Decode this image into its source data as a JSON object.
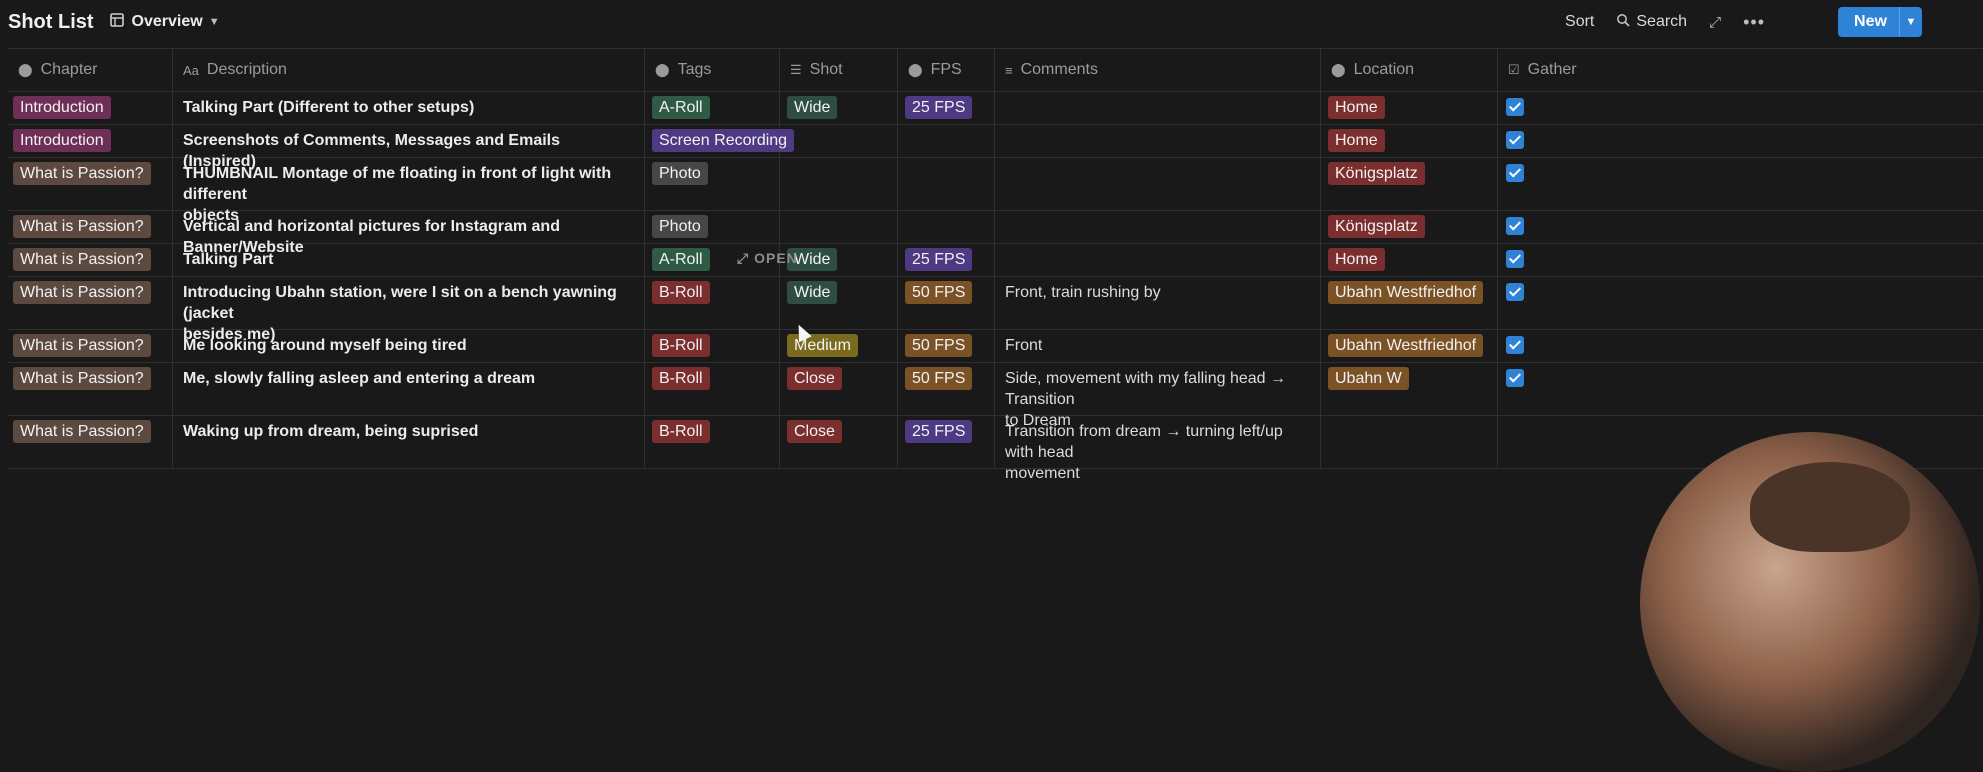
{
  "header": {
    "title": "Shot List",
    "view_label": "Overview",
    "sort_label": "Sort",
    "search_label": "Search",
    "new_label": "New"
  },
  "columns": [
    {
      "key": "chapter",
      "label": "Chapter",
      "icon": "select-icon"
    },
    {
      "key": "description",
      "label": "Description",
      "icon": "text-icon"
    },
    {
      "key": "tags",
      "label": "Tags",
      "icon": "select-icon"
    },
    {
      "key": "shot",
      "label": "Shot",
      "icon": "list-icon"
    },
    {
      "key": "fps",
      "label": "FPS",
      "icon": "select-icon"
    },
    {
      "key": "comments",
      "label": "Comments",
      "icon": "text-lines-icon"
    },
    {
      "key": "location",
      "label": "Location",
      "icon": "select-icon"
    },
    {
      "key": "gathered",
      "label": "Gather",
      "icon": "checkbox-icon"
    }
  ],
  "colors": {
    "introduction": "#6e2f57",
    "passion": "#5c4a41",
    "a_roll": "#2f5a46",
    "screen_recording": "#4e3a82",
    "photo": "#474747",
    "b_roll": "#7a2e2e",
    "wide": "#2e4e42",
    "medium": "#7a6a1e",
    "close": "#7a2e2e",
    "fps25": "#4e3a82",
    "fps50": "#7a5226",
    "home": "#7a2e2e",
    "konigsplatz": "#7a2e2e",
    "ubahn": "#7a5226",
    "accent": "#2f83d6"
  },
  "open_hint": "OPEN",
  "rows": [
    {
      "chapter": "Introduction",
      "chapter_color": "introduction",
      "description": [
        "Talking Part (Different to other setups)"
      ],
      "tags": "A-Roll",
      "tags_color": "a_roll",
      "shot": "Wide",
      "shot_color": "wide",
      "fps": "25 FPS",
      "fps_color": "fps25",
      "comments": [],
      "location": "Home",
      "location_color": "home",
      "gathered": true
    },
    {
      "chapter": "Introduction",
      "chapter_color": "introduction",
      "description": [
        "Screenshots of Comments, Messages and Emails (Inspired)"
      ],
      "tags": "Screen Recording",
      "tags_color": "screen_recording",
      "shot": "",
      "shot_color": "",
      "fps": "",
      "fps_color": "",
      "comments": [],
      "location": "Home",
      "location_color": "home",
      "gathered": true
    },
    {
      "chapter": "What is Passion?",
      "chapter_color": "passion",
      "description": [
        "THUMBNAIL Montage of me floating in front of light with different",
        "objects"
      ],
      "tags": "Photo",
      "tags_color": "photo",
      "shot": "",
      "shot_color": "",
      "fps": "",
      "fps_color": "",
      "comments": [],
      "location": "Königsplatz",
      "location_color": "konigsplatz",
      "gathered": true
    },
    {
      "chapter": "What is Passion?",
      "chapter_color": "passion",
      "description": [
        "Vertical and horizontal pictures for Instagram and Banner/Website"
      ],
      "tags": "Photo",
      "tags_color": "photo",
      "shot": "",
      "shot_color": "",
      "fps": "",
      "fps_color": "",
      "comments": [],
      "location": "Königsplatz",
      "location_color": "konigsplatz",
      "gathered": true
    },
    {
      "chapter": "What is Passion?",
      "chapter_color": "passion",
      "description": [
        "Talking Part"
      ],
      "tags": "A-Roll",
      "tags_color": "a_roll",
      "shot": "Wide",
      "shot_color": "wide",
      "fps": "25 FPS",
      "fps_color": "fps25",
      "comments": [],
      "location": "Home",
      "location_color": "home",
      "gathered": true
    },
    {
      "chapter": "What is Passion?",
      "chapter_color": "passion",
      "description": [
        "Introducing Ubahn station, were I sit on a bench yawning (jacket",
        "besides me)"
      ],
      "tags": "B-Roll",
      "tags_color": "b_roll",
      "shot": "Wide",
      "shot_color": "wide",
      "fps": "50 FPS",
      "fps_color": "fps50",
      "comments": [
        "Front, train rushing by"
      ],
      "location": "Ubahn Westfriedhof",
      "location_color": "ubahn",
      "gathered": true
    },
    {
      "chapter": "What is Passion?",
      "chapter_color": "passion",
      "description": [
        "Me looking around myself being tired"
      ],
      "tags": "B-Roll",
      "tags_color": "b_roll",
      "shot": "Medium",
      "shot_color": "medium",
      "fps": "50 FPS",
      "fps_color": "fps50",
      "comments": [
        "Front"
      ],
      "location": "Ubahn Westfriedhof",
      "location_color": "ubahn",
      "gathered": true
    },
    {
      "chapter": "What is Passion?",
      "chapter_color": "passion",
      "description": [
        "Me, slowly falling asleep and entering a dream"
      ],
      "tags": "B-Roll",
      "tags_color": "b_roll",
      "shot": "Close",
      "shot_color": "close",
      "fps": "50 FPS",
      "fps_color": "fps50",
      "comments": [
        "Side, movement with my falling head → Transition",
        "to Dream"
      ],
      "location": "Ubahn W",
      "location_color": "ubahn",
      "gathered": true
    },
    {
      "chapter": "What is Passion?",
      "chapter_color": "passion",
      "description": [
        "Waking up from dream, being suprised"
      ],
      "tags": "B-Roll",
      "tags_color": "b_roll",
      "shot": "Close",
      "shot_color": "close",
      "fps": "25 FPS",
      "fps_color": "fps25",
      "comments": [
        "Transition from dream → turning left/up with head",
        "movement"
      ],
      "location": "",
      "location_color": "",
      "gathered": false
    }
  ]
}
